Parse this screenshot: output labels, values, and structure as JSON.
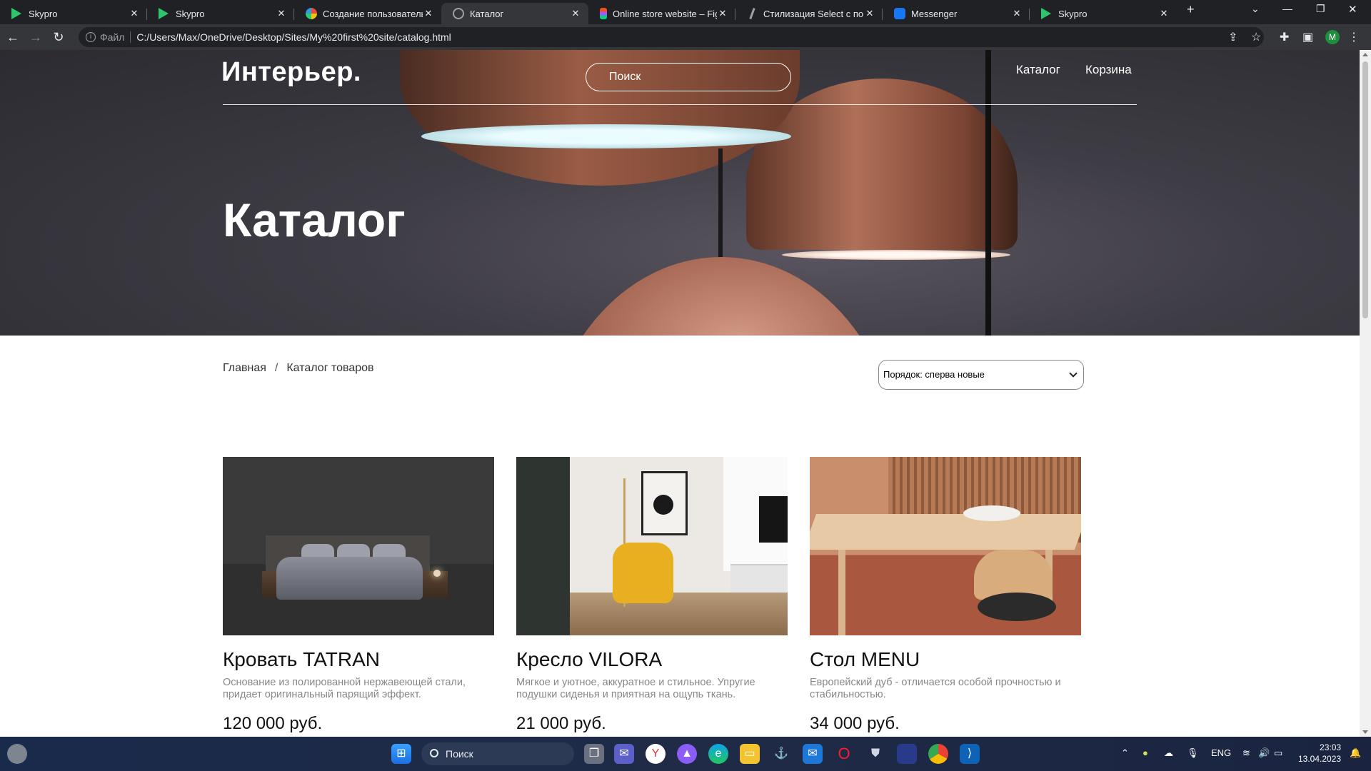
{
  "browser": {
    "tabs": [
      {
        "title": "Skypro",
        "icon": "skypro-icon",
        "active": false
      },
      {
        "title": "Skypro",
        "icon": "skypro-icon",
        "active": false
      },
      {
        "title": "Создание пользовательск",
        "icon": "multicolor-icon",
        "active": false
      },
      {
        "title": "Каталог",
        "icon": "globe-icon",
        "active": true
      },
      {
        "title": "Online store website – Fig",
        "icon": "figma-icon",
        "active": false
      },
      {
        "title": "Стилизация Select с помо",
        "icon": "pen-icon",
        "active": false
      },
      {
        "title": "Messenger",
        "icon": "messenger-icon",
        "active": false
      },
      {
        "title": "Skypro",
        "icon": "skypro-icon",
        "active": false
      }
    ],
    "address": {
      "scheme_label": "Файл",
      "url": "C:/Users/Max/OneDrive/Desktop/Sites/My%20first%20site/catalog.html"
    },
    "profile_initial": "M"
  },
  "header": {
    "logo": "Интерьер.",
    "search_placeholder": "Поиск",
    "nav": [
      {
        "label": "Каталог"
      },
      {
        "label": "Корзина"
      }
    ]
  },
  "hero": {
    "title": "Каталог"
  },
  "breadcrumb": {
    "home": "Главная",
    "separator": "/",
    "current": "Каталог товаров"
  },
  "sort": {
    "selected": "Порядок: сперва новые"
  },
  "products": [
    {
      "name": "Кровать TATRAN",
      "description": "Основание из полированной нержавеющей стали, придает оригинальный парящий эффект.",
      "price": "120 000 руб."
    },
    {
      "name": "Кресло VILORA",
      "description": "Мягкое и уютное, аккуратное и стильное. Упругие подушки сиденья и приятная на ощупь ткань.",
      "price": "21 000 руб."
    },
    {
      "name": "Стол MENU",
      "description": "Европейский дуб - отличается особой прочностью и стабильностью.",
      "price": "34 000 руб."
    }
  ],
  "taskbar": {
    "search_label": "Поиск",
    "language": "ENG",
    "time": "23:03",
    "date": "13.04.2023"
  }
}
